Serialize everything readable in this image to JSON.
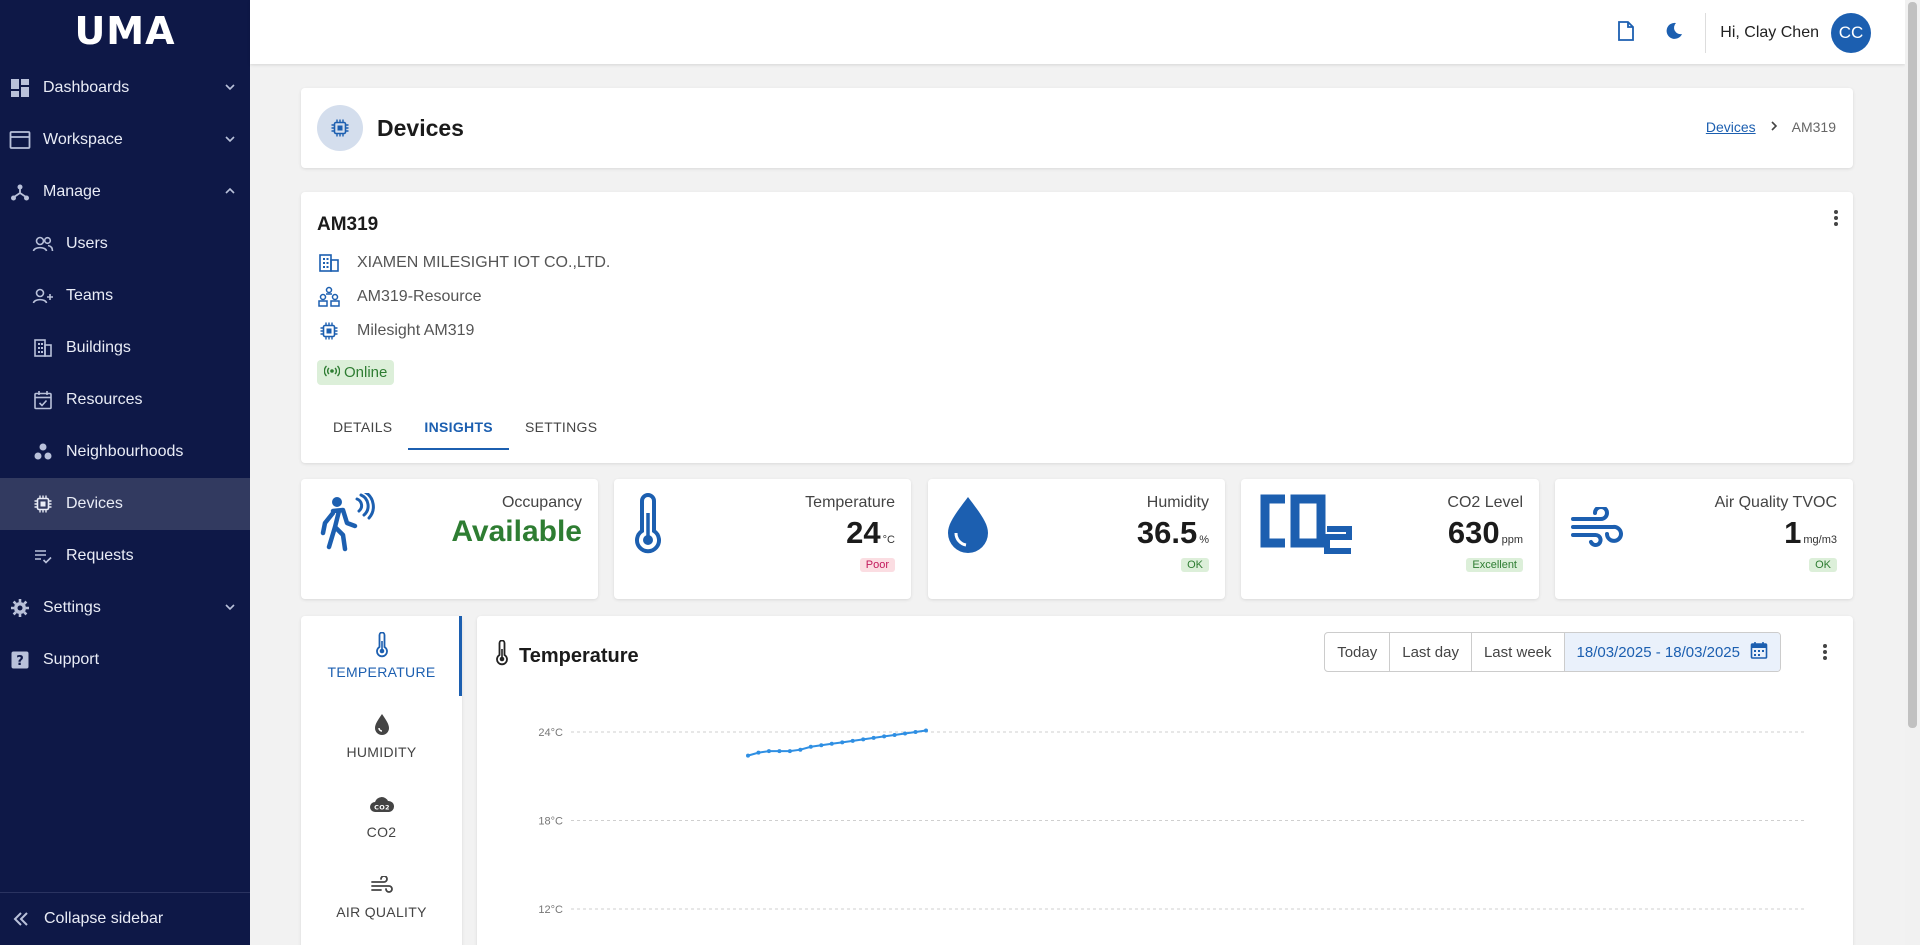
{
  "sidebar": {
    "logo": "UMA",
    "items": [
      {
        "label": "Dashboards"
      },
      {
        "label": "Workspace"
      },
      {
        "label": "Manage"
      },
      {
        "label": "Users"
      },
      {
        "label": "Teams"
      },
      {
        "label": "Buildings"
      },
      {
        "label": "Resources"
      },
      {
        "label": "Neighbourhoods"
      },
      {
        "label": "Devices"
      },
      {
        "label": "Requests"
      },
      {
        "label": "Settings"
      },
      {
        "label": "Support"
      }
    ],
    "collapse_label": "Collapse sidebar"
  },
  "topbar": {
    "greeting": "Hi, Clay Chen",
    "avatar_initials": "CC"
  },
  "page": {
    "title": "Devices",
    "breadcrumb": [
      "Devices",
      "AM319"
    ]
  },
  "device": {
    "name": "AM319",
    "company": "XIAMEN MILESIGHT IOT CO.,LTD.",
    "resource": "AM319-Resource",
    "model": "Milesight AM319",
    "status": "Online",
    "tabs": [
      "DETAILS",
      "INSIGHTS",
      "SETTINGS"
    ],
    "active_tab": "INSIGHTS"
  },
  "metrics": {
    "occupancy": {
      "label": "Occupancy",
      "value": "Available"
    },
    "temperature": {
      "label": "Temperature",
      "value": "24",
      "unit": "°C",
      "rating": "Poor"
    },
    "humidity": {
      "label": "Humidity",
      "value": "36.5",
      "unit": "%",
      "rating": "OK"
    },
    "co2": {
      "label": "CO2 Level",
      "value": "630",
      "unit": "ppm",
      "rating": "Excellent"
    },
    "tvoc": {
      "label": "Air Quality TVOC",
      "value": "1",
      "unit": "mg/m3",
      "rating": "OK"
    }
  },
  "sidetabs": [
    "TEMPERATURE",
    "HUMIDITY",
    "CO2",
    "AIR QUALITY"
  ],
  "chart": {
    "title": "Temperature",
    "ranges": [
      "Today",
      "Last day",
      "Last week"
    ],
    "date_range": "18/03/2025 - 18/03/2025"
  },
  "chart_data": {
    "type": "line",
    "title": "Temperature",
    "xlabel": "",
    "ylabel": "",
    "y_ticks": [
      "24°C",
      "18°C",
      "12°C"
    ],
    "tick_values": [
      24,
      18,
      12
    ],
    "grid": true,
    "series": [
      {
        "values": [
          22.4,
          22.6,
          22.7,
          22.7,
          22.7,
          22.8,
          23.0,
          23.1,
          23.2,
          23.3,
          23.4,
          23.5,
          23.6,
          23.7,
          23.8,
          23.9,
          24.0,
          24.1
        ]
      }
    ]
  },
  "colors": {
    "sidebar_bg": "#0e1847",
    "accent": "#1c5fb0",
    "success": "#2e7d32",
    "series": "#2f8fe3"
  }
}
